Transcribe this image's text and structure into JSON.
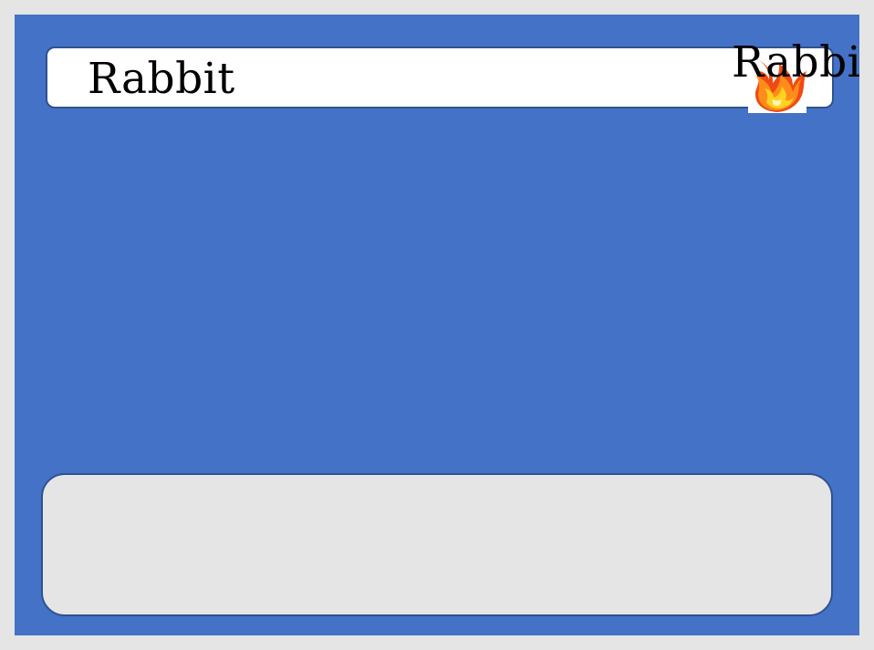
{
  "card": {
    "background_color": "#4472c6",
    "border_color": "#2f528f"
  },
  "name_bar": {
    "name": "Rabbit",
    "overflow_label": "Rabbit",
    "type_icon": "fire-icon"
  },
  "text_box": {
    "text": ""
  }
}
